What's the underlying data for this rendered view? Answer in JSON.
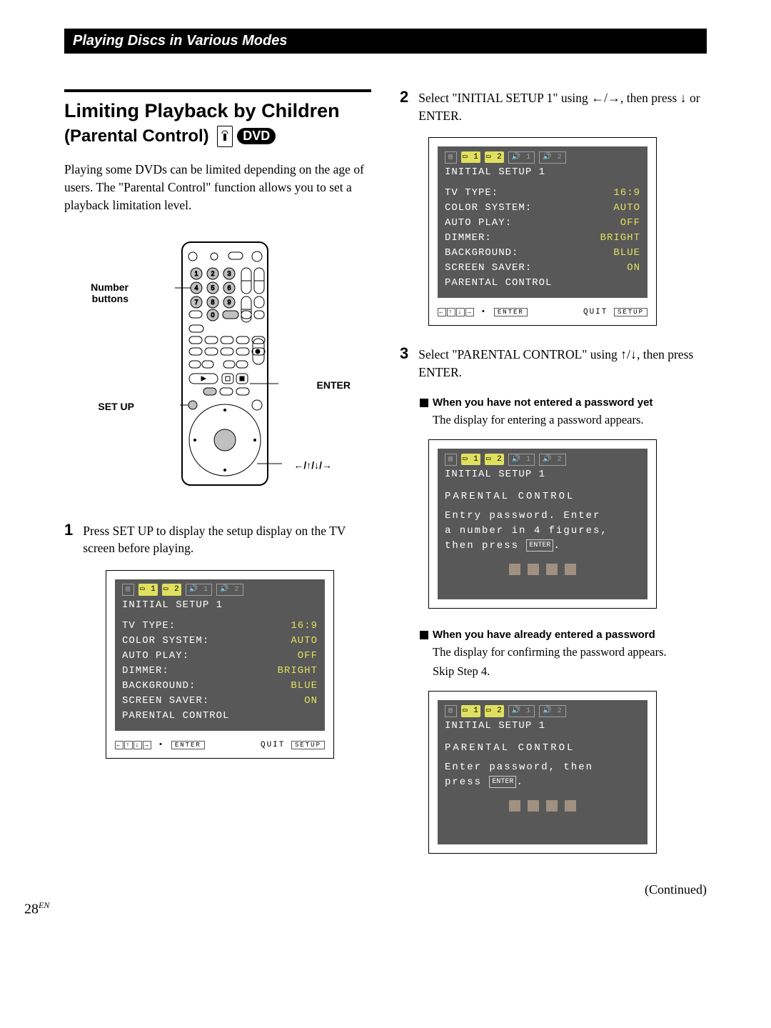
{
  "section_header": "Playing Discs in Various Modes",
  "title_line1": "Limiting Playback by Children",
  "title_line2": "(Parental Control)",
  "dvd_badge": "DVD",
  "intro": "Playing some DVDs can be limited depending on the age of users.  The \"Parental Control\" function allows you to set a playback limitation level.",
  "remote_labels": {
    "numbers": "Number buttons",
    "setup": "SET UP",
    "enter": "ENTER",
    "arrows": "</>/M/m/,"
  },
  "step1": {
    "n": "1",
    "text": "Press SET UP to display the setup display on the TV screen before playing."
  },
  "step2": {
    "n": "2",
    "text_a": "Select \"INITIAL SETUP 1\" using ",
    "arrows": "</,",
    "text_b": ", then press ",
    "arrow2": "m",
    "text_c": " or ENTER."
  },
  "step3": {
    "n": "3",
    "text_a": "Select \"PARENTAL CONTROL\" using ",
    "arrows": ">/m",
    "text_b": ", then press ENTER."
  },
  "osd": {
    "icon_bar": {
      "hl1": "1",
      "hl2": "2",
      "sp1": "1",
      "sp2": "2"
    },
    "title": "INITIAL SETUP 1",
    "rows": [
      {
        "label": "TV TYPE:",
        "value": "16:9"
      },
      {
        "label": "COLOR SYSTEM:",
        "value": "AUTO"
      },
      {
        "label": "AUTO PLAY:",
        "value": "OFF"
      },
      {
        "label": "DIMMER:",
        "value": "BRIGHT"
      },
      {
        "label": "BACKGROUND:",
        "value": "BLUE"
      },
      {
        "label": "SCREEN SAVER:",
        "value": "ON"
      },
      {
        "label": "PARENTAL CONTROL",
        "value": ""
      }
    ],
    "foot_enter": "ENTER",
    "foot_quit": "QUIT",
    "foot_setup": "SETUP"
  },
  "osd_pw_new": {
    "sub": "PARENTAL CONTROL",
    "msg1": "Entry password.  Enter",
    "msg2": "a  number  in  4  figures,",
    "msg3": "then  press  ",
    "enter": "ENTER"
  },
  "osd_pw_exist": {
    "sub": "PARENTAL CONTROL",
    "msg1": "Enter  password,   then",
    "msg2": "press   ",
    "enter": "ENTER"
  },
  "subhead1": "When you have not entered a password yet",
  "subbody1": "The display for entering a password appears.",
  "subhead2": "When you have already entered a password",
  "subbody2a": "The display for confirming the password appears.",
  "subbody2b": "Skip Step 4.",
  "continued": "(Continued)",
  "page_num": "28",
  "page_suffix": "EN"
}
